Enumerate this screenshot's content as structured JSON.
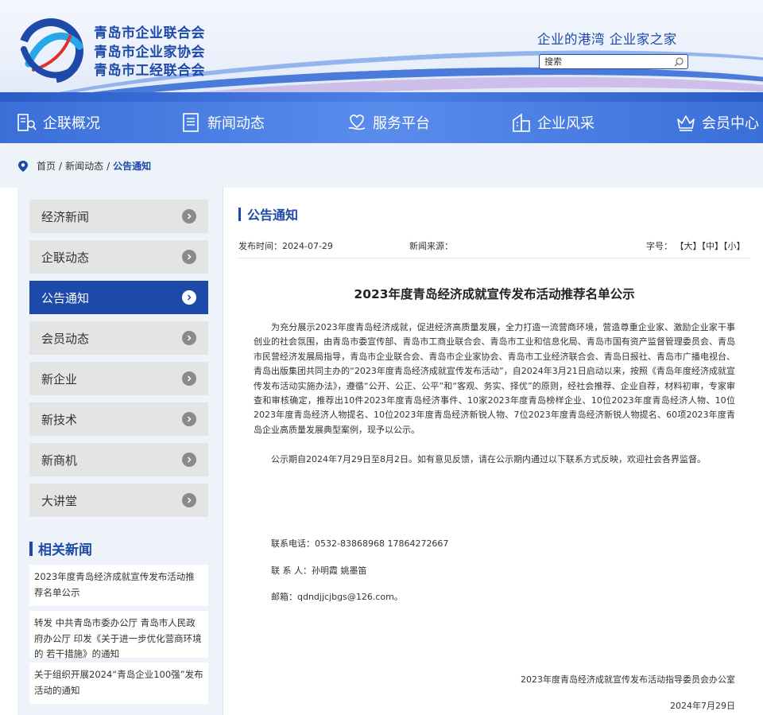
{
  "header": {
    "org_names": [
      "青岛市企业联合会",
      "青岛市企业家协会",
      "青岛市工经联合会"
    ],
    "slogan": "企业的港湾  企业家之家",
    "search_placeholder": "搜索"
  },
  "nav": {
    "items": [
      {
        "label": "企联概况",
        "icon": "building-icon"
      },
      {
        "label": "新闻动态",
        "icon": "news-icon"
      },
      {
        "label": "服务平台",
        "icon": "heart-hand-icon"
      },
      {
        "label": "企业风采",
        "icon": "company-icon"
      },
      {
        "label": "会员中心",
        "icon": "crown-icon"
      }
    ]
  },
  "breadcrumb": {
    "home": "首页",
    "sep": "/",
    "parent": "新闻动态",
    "current": "公告通知"
  },
  "sidebar": {
    "items": [
      {
        "label": "经济新闻",
        "active": false
      },
      {
        "label": "企联动态",
        "active": false
      },
      {
        "label": "公告通知",
        "active": true
      },
      {
        "label": "会员动态",
        "active": false
      },
      {
        "label": "新企业",
        "active": false
      },
      {
        "label": "新技术",
        "active": false
      },
      {
        "label": "新商机",
        "active": false
      },
      {
        "label": "大讲堂",
        "active": false
      }
    ],
    "related_title": "相关新闻",
    "related": [
      "2023年度青岛经济成就宣传发布活动推荐名单公示",
      "转发 中共青岛市委办公厅 青岛市人民政府办公厅 印发《关于进一步优化营商环境的 若干措施》的通知",
      "关于组织开展2024“青岛企业100强”发布活动的通知"
    ]
  },
  "article": {
    "section_title": "公告通知",
    "publish_time_label": "发布时间：",
    "publish_time": "2024-07-29",
    "source_label": "新闻来源：",
    "font_size_label": "字号：",
    "font_sizes": [
      "【大】",
      "【中】",
      "【小】"
    ],
    "title": "2023年度青岛经济成就宣传发布活动推荐名单公示",
    "paragraph1": "为充分展示2023年度青岛经济成就，促进经济高质量发展，全力打造一流营商环境，营造尊重企业家、激励企业家干事创业的社会氛围，由青岛市委宣传部、青岛市工商业联合会、青岛市工业和信息化局、青岛市国有资产监督管理委员会、青岛市民营经济发展局指导，青岛市企业联合会、青岛市企业家协会、青岛市工业经济联合会、青岛日报社、青岛市广播电视台、青岛出版集团共同主办的“2023年度青岛经济成就宣传发布活动”，自2024年3月21日启动以来，按照《青岛年度经济成就宣传发布活动实施办法》，遵循“公开、公正、公平”和“客观、务实、择优”的原则，经社会推荐、企业自荐，材料初审，专家审查和审核确定，推荐出10件2023年度青岛经济事件、10家2023年度青岛榜样企业、10位2023年度青岛经济人物、10位2023年度青岛经济人物提名、10位2023年度青岛经济新锐人物、7位2023年度青岛经济新锐人物提名、60项2023年度青岛企业高质量发展典型案例，现予以公示。",
    "paragraph2": "公示期自2024年7月29日至8月2日。如有意见反馈，请在公示期内通过以下联系方式反映，欢迎社会各界监督。",
    "phone": "联系电话：0532-83868968 17864272667",
    "contact_person": "联 系 人：孙明霞  姚墨笛",
    "email": "邮箱：qdndjjcjbgs@126.com。",
    "signer": "2023年度青岛经济成就宣传发布活动指导委员会办公室",
    "sign_date": "2024年7月29日"
  },
  "colors": {
    "brand": "#1d4aa8",
    "nav_bg": "#4b80e6",
    "sidebar_item": "#e4e4e4",
    "page_bg": "#eef2f9"
  }
}
